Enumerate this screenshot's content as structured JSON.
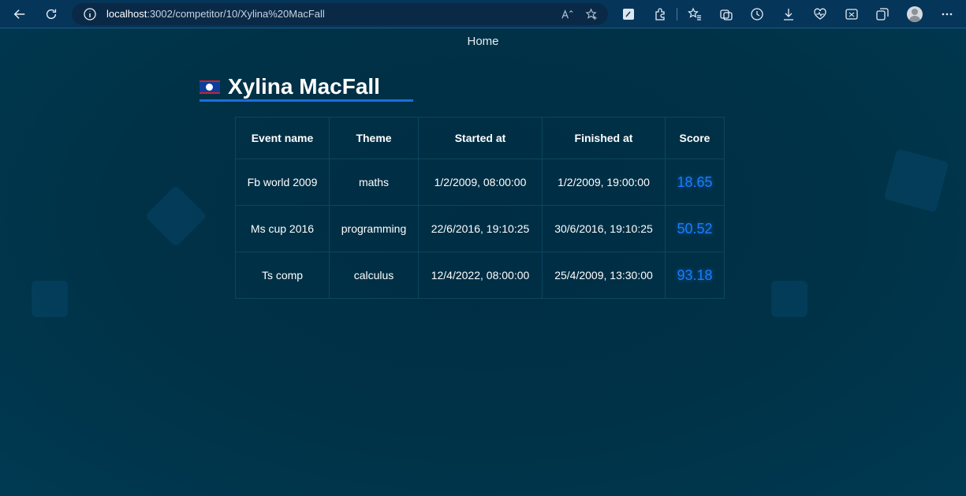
{
  "browser": {
    "url_host": "localhost",
    "url_rest": ":3002/competitor/10/Xylina%20MacFall"
  },
  "nav": {
    "home_label": "Home"
  },
  "profile": {
    "name": "Xylina MacFall",
    "flag_icon": "belize-flag-icon"
  },
  "table": {
    "headers": {
      "event": "Event name",
      "theme": "Theme",
      "started": "Started at",
      "finished": "Finished at",
      "score": "Score"
    },
    "rows": [
      {
        "event": "Fb world 2009",
        "theme": "maths",
        "started": "1/2/2009, 08:00:00",
        "finished": "1/2/2009, 19:00:00",
        "score": "18.65"
      },
      {
        "event": "Ms cup 2016",
        "theme": "programming",
        "started": "22/6/2016, 19:10:25",
        "finished": "30/6/2016, 19:10:25",
        "score": "50.52"
      },
      {
        "event": "Ts comp",
        "theme": "calculus",
        "started": "12/4/2022, 08:00:00",
        "finished": "25/4/2009, 13:30:00",
        "score": "93.18"
      }
    ]
  },
  "colors": {
    "accent": "#1a6fe0",
    "score": "#1a7cff",
    "background": "#003046"
  }
}
